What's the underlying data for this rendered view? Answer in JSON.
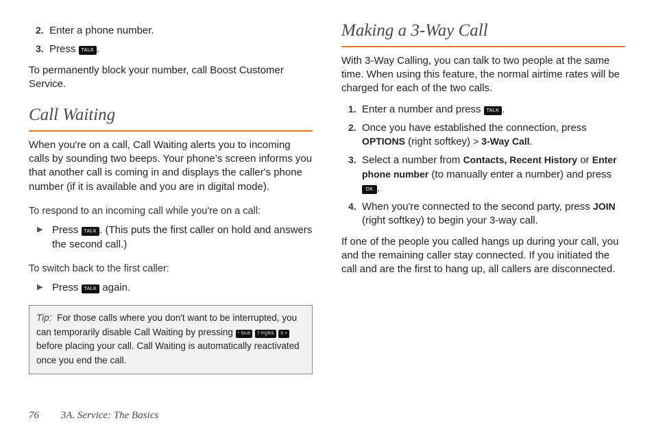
{
  "left": {
    "list_top": [
      {
        "num": "2.",
        "text": "Enter a phone number."
      },
      {
        "num": "3.",
        "pre": "Press ",
        "key": "TALK",
        "post": "."
      }
    ],
    "perm_block": "To permanently block your number, call Boost Customer Service.",
    "heading_cw": "Call Waiting",
    "cw_intro": "When you're on a call, Call Waiting alerts you to incoming calls by sounding two beeps. Your phone's screen informs you that another call is coming in and displays the caller's phone number (if it is available and you are in digital mode).",
    "respond_label": "To respond to an incoming call while you're on a call:",
    "respond_bullet": {
      "pre": "Press ",
      "key": "TALK",
      "post": ". (This puts the first caller on hold and answers the second call.)"
    },
    "switch_label": "To switch back to the first caller:",
    "switch_bullet": {
      "pre": "Press ",
      "key": "TALK",
      "post": " again."
    },
    "tip": {
      "label": "Tip:",
      "part1": "For those calls where you don't want to be interrupted, you can temporarily disable Call Waiting by pressing ",
      "key1": "* Shift",
      "key2": "7 PQRS",
      "key3": "0 +",
      "part2": " before placing your call. Call Waiting is automatically reactivated once you end the call."
    }
  },
  "right": {
    "heading_3w": "Making a 3-Way Call",
    "intro_3w": "With 3-Way Calling, you can talk to two people at the same time. When using this feature, the normal airtime rates will be charged for each of the two calls.",
    "step1": {
      "num": "1.",
      "pre": "Enter a number and press ",
      "key": "TALK",
      "post": "."
    },
    "step2": {
      "num": "2.",
      "pre": "Once you have established the connection, press ",
      "b1": "OPTIONS",
      "mid": " (right softkey) ",
      "gt": ">",
      "b2": " 3-Way Call",
      "post": "."
    },
    "step3": {
      "num": "3.",
      "pre": "Select a number from ",
      "b1": "Contacts, Recent History",
      "mid": " or ",
      "b2": "Enter phone number",
      "post1": " (to manually enter a number) and press ",
      "key": "OK",
      "post2": "."
    },
    "step4": {
      "num": "4.",
      "pre": "When you're connected to the second party, press ",
      "b1": "JOIN",
      "post": " (right softkey) to begin your 3-way call."
    },
    "outro_3w": "If one of the people you called hangs up during your call, you and the remaining caller stay connected. If you initiated the call and are the first to hang up, all callers are disconnected."
  },
  "footer": {
    "page": "76",
    "section": "3A. Service: The Basics"
  }
}
